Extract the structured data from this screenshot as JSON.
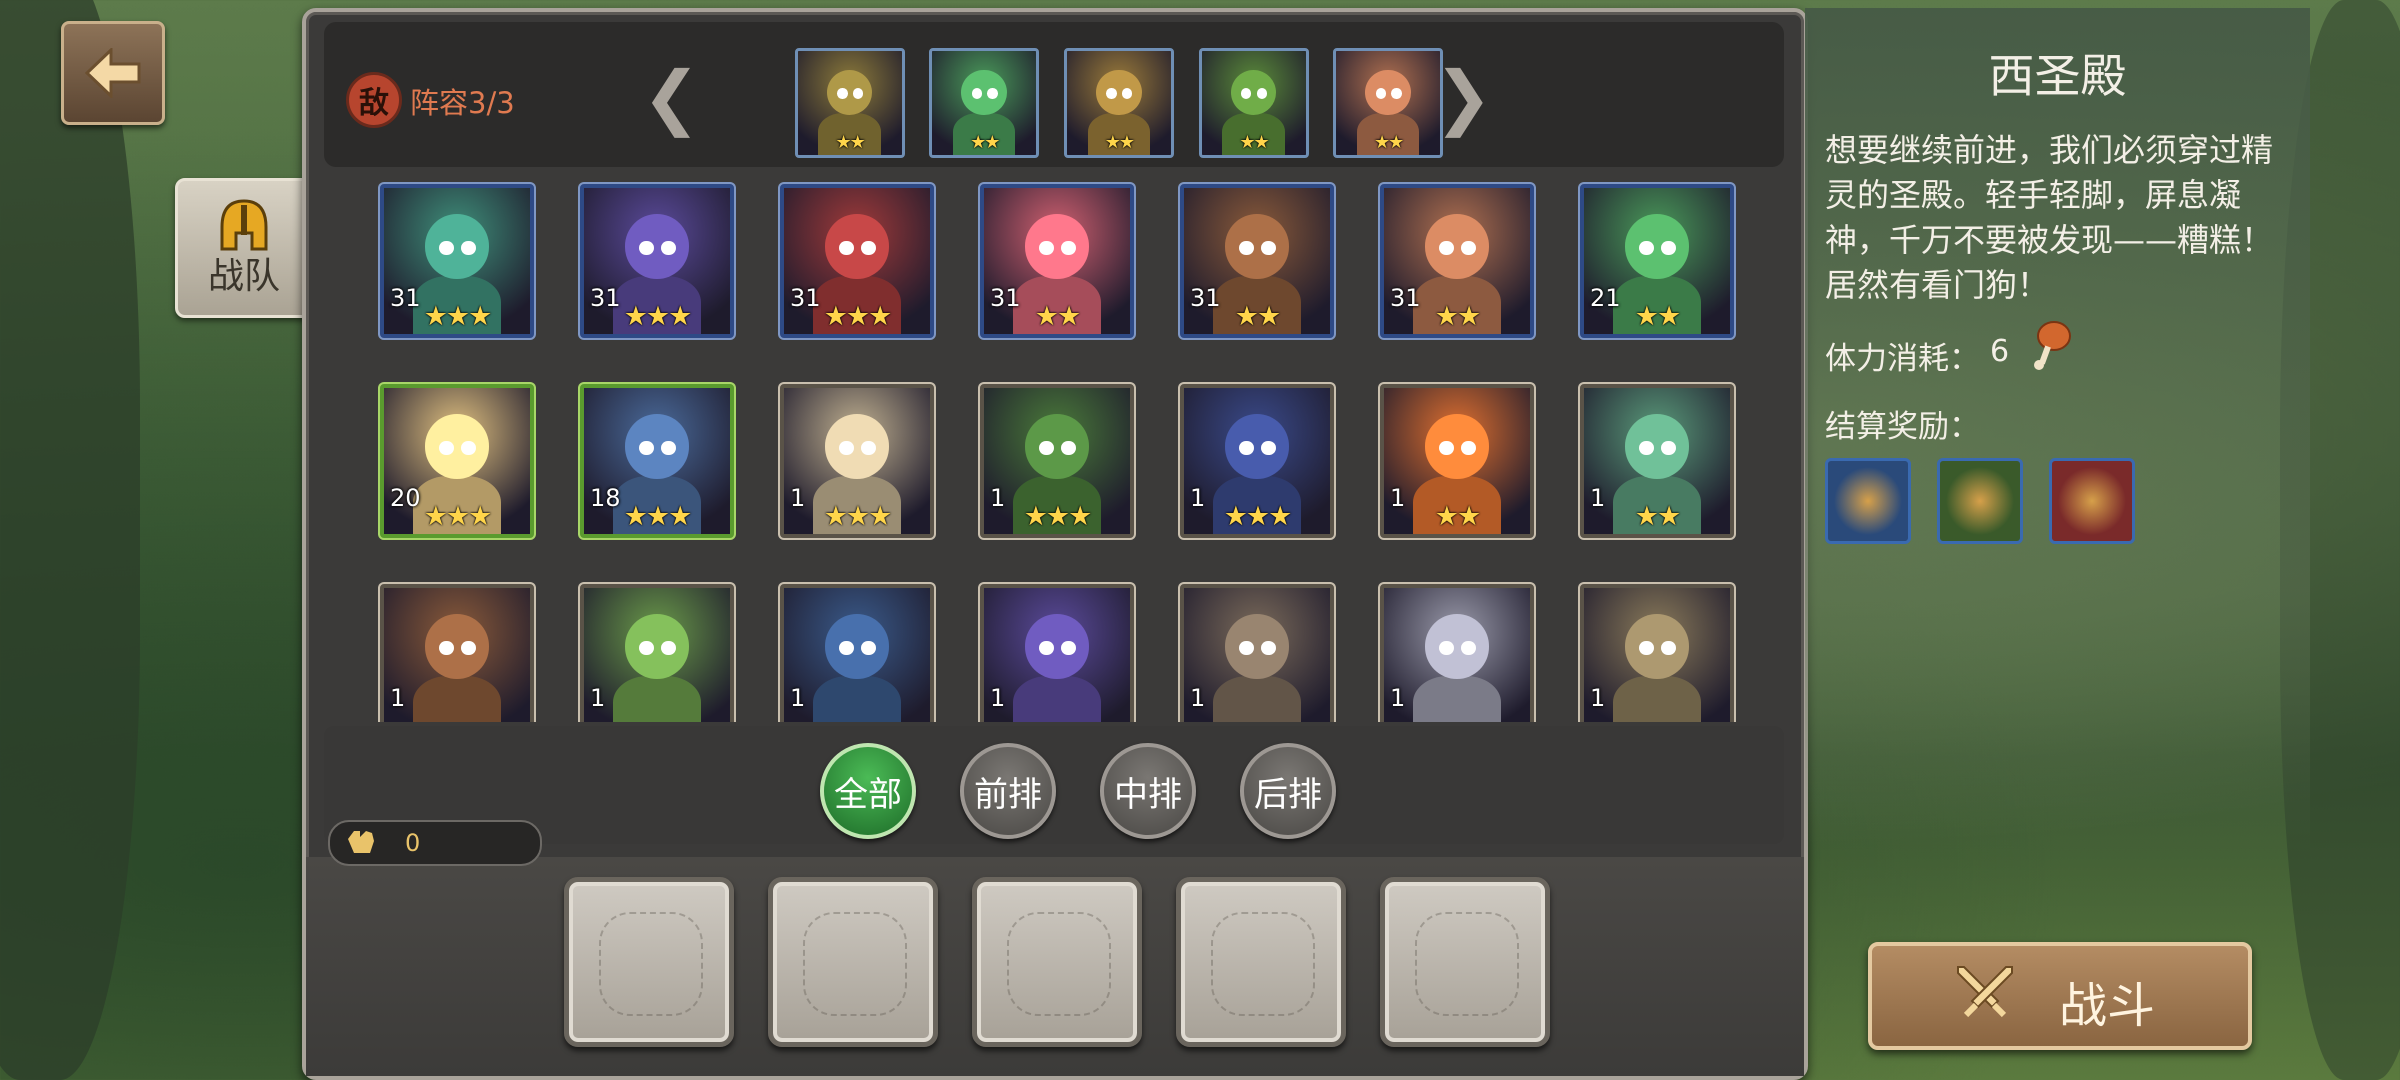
{
  "nav": {
    "back_icon": "arrow-left-icon",
    "team_tab": "战队"
  },
  "enemy": {
    "badge": "敌",
    "lineup_label": "阵容3/3",
    "lineup": [
      {
        "stars": "★★",
        "color": "#8c7a3a"
      },
      {
        "stars": "★★",
        "color": "#4a9a5a"
      },
      {
        "stars": "★★",
        "color": "#9a7a3a"
      },
      {
        "stars": "★★",
        "color": "#5a8a3a"
      },
      {
        "stars": "★★",
        "color": "#b07050"
      }
    ]
  },
  "heroes": [
    {
      "level": "31",
      "stars": "★★★",
      "frame": "blue",
      "color": "#3f8f7a"
    },
    {
      "level": "31",
      "stars": "★★★",
      "frame": "blue",
      "color": "#5a4a9a"
    },
    {
      "level": "31",
      "stars": "★★★",
      "frame": "blue",
      "color": "#a03a3a"
    },
    {
      "level": "31",
      "stars": "★★",
      "frame": "blue",
      "color": "#d06070"
    },
    {
      "level": "31",
      "stars": "★★",
      "frame": "blue",
      "color": "#8a5a3a"
    },
    {
      "level": "31",
      "stars": "★★",
      "frame": "blue",
      "color": "#b07050"
    },
    {
      "level": "21",
      "stars": "★★",
      "frame": "blue",
      "color": "#4a9a5a"
    },
    {
      "level": "20",
      "stars": "★★★",
      "frame": "green",
      "color": "#e0c080"
    },
    {
      "level": "18",
      "stars": "★★★",
      "frame": "green",
      "color": "#4a6a9a"
    },
    {
      "level": "1",
      "stars": "★★★",
      "frame": "gray",
      "color": "#c0b090"
    },
    {
      "level": "1",
      "stars": "★★★",
      "frame": "gray",
      "color": "#4a7a3a"
    },
    {
      "level": "1",
      "stars": "★★★",
      "frame": "gray",
      "color": "#3a4a8a"
    },
    {
      "level": "1",
      "stars": "★★",
      "frame": "gray",
      "color": "#e07030"
    },
    {
      "level": "1",
      "stars": "★★",
      "frame": "gray",
      "color": "#5a9a7a"
    },
    {
      "level": "1",
      "stars": "",
      "frame": "gray",
      "color": "#8a5a3a"
    },
    {
      "level": "1",
      "stars": "",
      "frame": "gray",
      "color": "#6a9a4a"
    },
    {
      "level": "1",
      "stars": "",
      "frame": "gray",
      "color": "#3a5a8a"
    },
    {
      "level": "1",
      "stars": "",
      "frame": "gray",
      "color": "#5a4a9a"
    },
    {
      "level": "1",
      "stars": "",
      "frame": "gray",
      "color": "#7a6a5a"
    },
    {
      "level": "1",
      "stars": "",
      "frame": "gray",
      "color": "#9a9aaa"
    },
    {
      "level": "1",
      "stars": "",
      "frame": "gray",
      "color": "#8a7a5a"
    }
  ],
  "filters": [
    {
      "label": "全部",
      "active": true
    },
    {
      "label": "前排",
      "active": false
    },
    {
      "label": "中排",
      "active": false
    },
    {
      "label": "后排",
      "active": false
    }
  ],
  "power": {
    "icon": "fist-icon",
    "value": "0"
  },
  "stage": {
    "title": "西圣殿",
    "description": "想要继续前进，我们必须穿过精灵的圣殿。轻手轻脚，屏息凝神，千万不要被发现——糟糕！居然有看门狗！",
    "stamina_label": "体力消耗：",
    "stamina_value": "6",
    "stamina_icon": "meat-icon",
    "reward_label": "结算奖励：",
    "rewards": [
      {
        "icon": "amulet-icon",
        "color": "#2a4a7a"
      },
      {
        "icon": "boots-icon",
        "color": "#3a5a2a"
      },
      {
        "icon": "scroll-icon",
        "color": "#7a2a2a"
      }
    ]
  },
  "fight_button": {
    "label": "战斗",
    "icon": "crossed-swords-icon"
  }
}
